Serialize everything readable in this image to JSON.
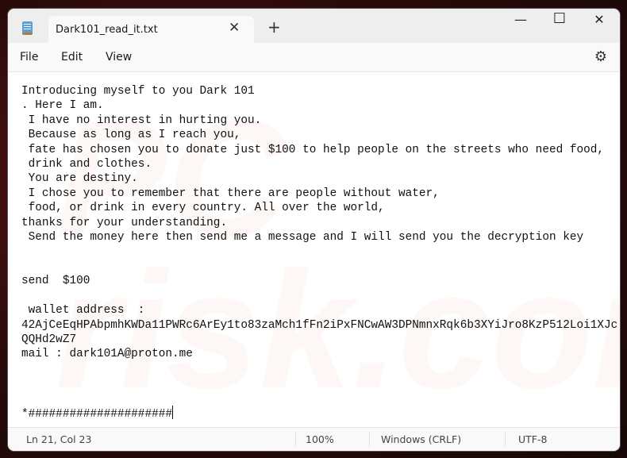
{
  "window": {
    "tab_title": "Dark101_read_it.txt",
    "icons": {
      "app": "notepad-icon",
      "close_tab": "close-icon",
      "new_tab": "plus-icon",
      "minimize": "minimize-icon",
      "maximize": "maximize-icon",
      "close": "close-icon",
      "settings": "gear-icon"
    },
    "glyphs": {
      "close_tab": "✕",
      "new_tab": "+",
      "minimize": "—",
      "maximize": "☐",
      "close": "✕",
      "settings": "⚙"
    }
  },
  "menu": {
    "file": "File",
    "edit": "Edit",
    "view": "View"
  },
  "editor": {
    "content": "Introducing myself to you Dark 101\n. Here I am.\n I have no interest in hurting you.\n Because as long as I reach you,\n fate has chosen you to donate just $100 to help people on the streets who need food,\n drink and clothes.\n You are destiny.\n I chose you to remember that there are people without water,\n food, or drink in every country. All over the world,\nthanks for your understanding.\n Send the money here then send me a message and I will send you the decryption key\n\n\nsend  $100\n\n wallet address  :\n42AjCeEqHPAbpmhKWDa11PWRc6ArEy1to83zaMch1fFn2iPxFNCwAW3DPNmnxRqk6b3XYiJro8KzP512Loi1XJc\nQQHd2wZ7\nmail : dark101A@proton.me\n\n\n\n*#####################"
  },
  "status": {
    "position": "Ln 21, Col 23",
    "zoom": "100%",
    "line_ending": "Windows (CRLF)",
    "encoding": "UTF-8"
  }
}
